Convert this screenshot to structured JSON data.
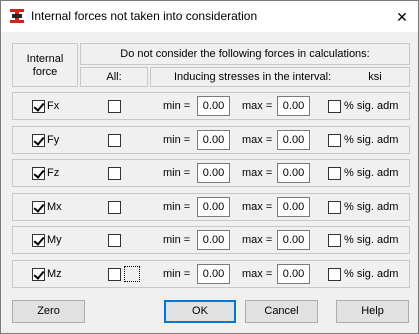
{
  "window": {
    "title": "Internal forces not taken into consideration",
    "close_glyph": "✕"
  },
  "header": {
    "internal_force": "Internal\nforce",
    "do_not_consider": "Do not consider the following forces in calculations:",
    "all": "All:",
    "inducing": "Inducing stresses in the interval:",
    "unit": "ksi"
  },
  "rows": [
    {
      "force": "Fx",
      "checked": true,
      "all_checked": false,
      "min_label": "min =",
      "min": "0.00",
      "max_label": "max =",
      "max": "0.00",
      "pct_label": "% sig. adm",
      "pct_checked": false
    },
    {
      "force": "Fy",
      "checked": true,
      "all_checked": false,
      "min_label": "min =",
      "min": "0.00",
      "max_label": "max =",
      "max": "0.00",
      "pct_label": "% sig. adm",
      "pct_checked": false
    },
    {
      "force": "Fz",
      "checked": true,
      "all_checked": false,
      "min_label": "min =",
      "min": "0.00",
      "max_label": "max =",
      "max": "0.00",
      "pct_label": "% sig. adm",
      "pct_checked": false
    },
    {
      "force": "Mx",
      "checked": true,
      "all_checked": false,
      "min_label": "min =",
      "min": "0.00",
      "max_label": "max =",
      "max": "0.00",
      "pct_label": "% sig. adm",
      "pct_checked": false
    },
    {
      "force": "My",
      "checked": true,
      "all_checked": false,
      "min_label": "min =",
      "min": "0.00",
      "max_label": "max =",
      "max": "0.00",
      "pct_label": "% sig. adm",
      "pct_checked": false
    },
    {
      "force": "Mz",
      "checked": true,
      "all_checked": false,
      "min_label": "min =",
      "min": "0.00",
      "max_label": "max =",
      "max": "0.00",
      "pct_label": "% sig. adm",
      "pct_checked": false
    }
  ],
  "buttons": {
    "zero": "Zero",
    "ok": "OK",
    "cancel": "Cancel",
    "help": "Help"
  },
  "colors": {
    "default_button_border": "#0078d7",
    "icon_red": "#d42020"
  }
}
